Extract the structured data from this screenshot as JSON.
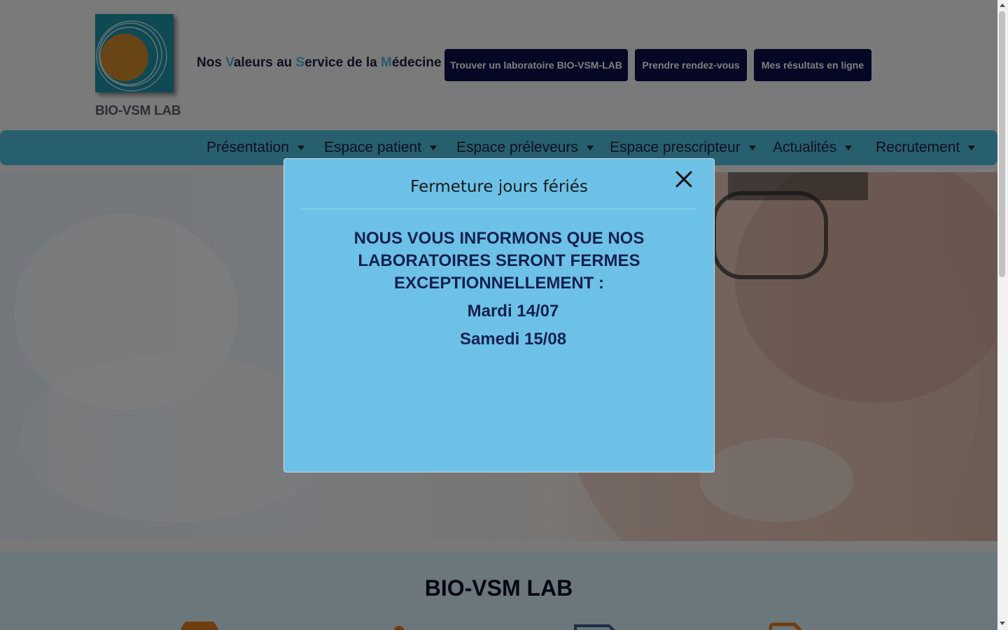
{
  "header": {
    "logo_text": "BIO-VSM LAB",
    "tagline_parts": [
      {
        "text": "Nos ",
        "hl": false
      },
      {
        "text": "V",
        "hl": true
      },
      {
        "text": "aleurs au ",
        "hl": false
      },
      {
        "text": "S",
        "hl": true
      },
      {
        "text": "ervice de la ",
        "hl": false
      },
      {
        "text": "M",
        "hl": true
      },
      {
        "text": "édecine",
        "hl": false
      }
    ],
    "buttons": {
      "find_lab": "Trouver un laboratoire BIO-VSM-LAB",
      "appointment": "Prendre rendez-vous",
      "results": "Mes résultats en ligne"
    }
  },
  "nav": {
    "items": [
      {
        "label": "Présentation"
      },
      {
        "label": "Espace patient"
      },
      {
        "label": "Espace préleveurs"
      },
      {
        "label": "Espace prescripteur"
      },
      {
        "label": "Actualités"
      },
      {
        "label": "Recrutement"
      }
    ]
  },
  "section": {
    "title": "BIO-VSM LAB"
  },
  "modal": {
    "title": "Fermeture jours fériés",
    "message": "NOUS VOUS INFORMONS QUE NOS LABORATOIRES SERONT FERMES EXCEPTIONNELLEMENT :",
    "dates": [
      "Mardi 14/07",
      "Samedi 15/08"
    ]
  },
  "colors": {
    "brand_teal": "#1f93a8",
    "logo_orange": "#d38b2a",
    "nav_blue": "#4fbfdc",
    "button_navy": "#0b0e4a",
    "tagline_highlight": "#4db8d8",
    "modal_bg": "#6dc1e7",
    "modal_text": "#13214f",
    "icon_orange": "#e07a1f"
  },
  "icons": [
    "logo-rings",
    "close-icon",
    "caret-down-icon",
    "feature-icon"
  ]
}
